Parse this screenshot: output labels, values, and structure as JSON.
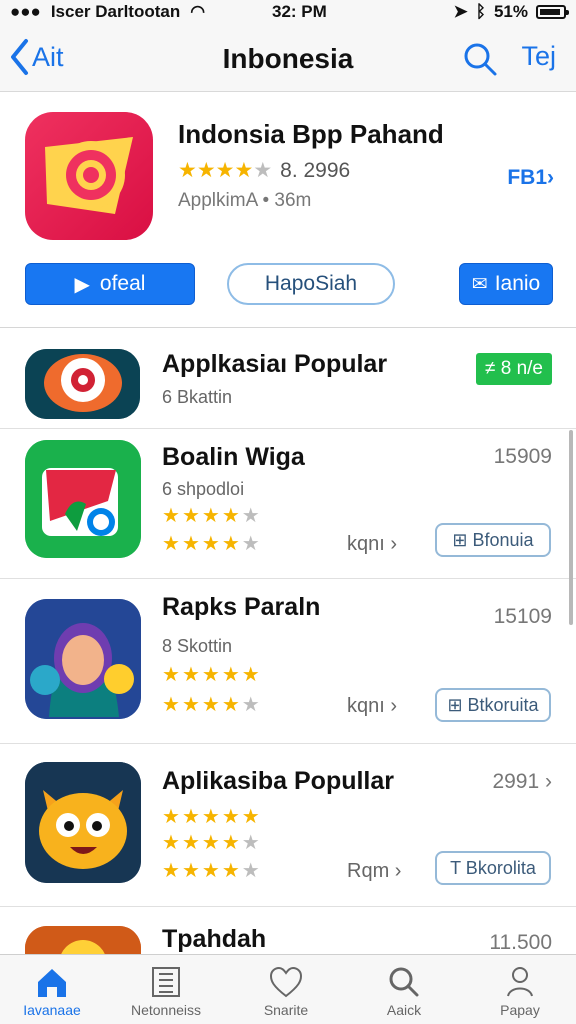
{
  "status": {
    "carrier": "Iscer Darltootan",
    "time": "32: PM",
    "battery": "51%"
  },
  "nav": {
    "back": "Ait",
    "title": "Inbonesia",
    "right": "Tej"
  },
  "featured": {
    "title": "Indonsia Bpp Pahand",
    "rating_text": "8. 2996",
    "meta": "ApplkimA  •  36m",
    "link": "FB1›",
    "play_label": "ofeal",
    "outline_label": "HapoSiah",
    "mail_label": "Ianio",
    "rating": 4
  },
  "apps": [
    {
      "title": "Applkasiaı Popular",
      "subtitle": "6 Bkattin",
      "badge": "≠ 8 n/e"
    },
    {
      "title": "Boalin Wiga",
      "subtitle": "6 shpodloi",
      "number": "15909",
      "link": "kqnı ›",
      "chip": "⊞ Bfonuia",
      "ratings": [
        4,
        4
      ]
    },
    {
      "title": "Rapks Paraln",
      "subtitle": "8 Skottin",
      "number": "15109",
      "link": "kqnı ›",
      "chip": "⊞ Btkoruita",
      "ratings": [
        5,
        4
      ]
    },
    {
      "title": "Aplikasiba Popullar",
      "number": "2991 ›",
      "link": "Rqm ›",
      "chip": "T Bkorolita",
      "ratings": [
        5,
        4,
        4
      ]
    },
    {
      "title": "Tpahdah",
      "number": "11.500"
    }
  ],
  "tabs": [
    "Iavanaae",
    "Netonneiss",
    "Snarite",
    "Aaick",
    "Papay"
  ]
}
